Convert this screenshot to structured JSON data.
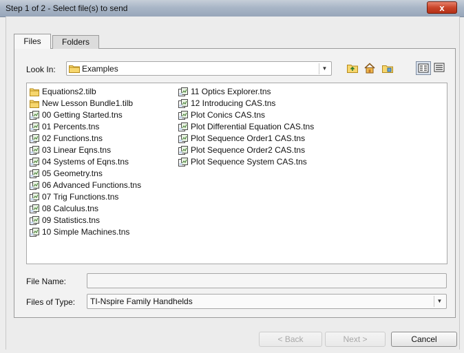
{
  "window": {
    "title": "Step 1 of 2 - Select file(s) to send",
    "close_label": "x"
  },
  "tabs": [
    {
      "label": "Files",
      "selected": true
    },
    {
      "label": "Folders",
      "selected": false
    }
  ],
  "look_in": {
    "label": "Look In:",
    "value": "Examples"
  },
  "toolbar": {
    "icons": [
      "up-folder-icon",
      "home-icon",
      "new-folder-icon",
      "list-view-icon",
      "details-view-icon"
    ]
  },
  "files": {
    "column1": [
      {
        "name": "Equations2.tilb",
        "type": "folder"
      },
      {
        "name": "New Lesson Bundle1.tilb",
        "type": "folder"
      },
      {
        "name": "00 Getting Started.tns",
        "type": "tns"
      },
      {
        "name": "01 Percents.tns",
        "type": "tns"
      },
      {
        "name": "02 Functions.tns",
        "type": "tns"
      },
      {
        "name": "03 Linear Eqns.tns",
        "type": "tns"
      },
      {
        "name": "04 Systems of Eqns.tns",
        "type": "tns"
      },
      {
        "name": "05 Geometry.tns",
        "type": "tns"
      },
      {
        "name": "06 Advanced Functions.tns",
        "type": "tns"
      },
      {
        "name": "07 Trig Functions.tns",
        "type": "tns"
      },
      {
        "name": "08 Calculus.tns",
        "type": "tns"
      },
      {
        "name": "09 Statistics.tns",
        "type": "tns"
      },
      {
        "name": "10 Simple Machines.tns",
        "type": "tns"
      }
    ],
    "column2": [
      {
        "name": "11 Optics Explorer.tns",
        "type": "tns"
      },
      {
        "name": "12 Introducing CAS.tns",
        "type": "tns"
      },
      {
        "name": "Plot Conics CAS.tns",
        "type": "tns"
      },
      {
        "name": "Plot Differential Equation CAS.tns",
        "type": "tns"
      },
      {
        "name": "Plot Sequence Order1 CAS.tns",
        "type": "tns"
      },
      {
        "name": "Plot Sequence Order2 CAS.tns",
        "type": "tns"
      },
      {
        "name": "Plot Sequence System CAS.tns",
        "type": "tns"
      }
    ]
  },
  "file_name": {
    "label": "File Name:",
    "value": ""
  },
  "file_type": {
    "label": "Files of Type:",
    "value": "TI-Nspire Family Handhelds"
  },
  "buttons": {
    "back": "< Back",
    "next": "Next >",
    "cancel": "Cancel"
  },
  "colors": {
    "title_gradient": "#a9b6c7",
    "close_red": "#c9452a",
    "folder_yellow": "#f3cf5a",
    "tns_green": "#5a8a3c"
  }
}
